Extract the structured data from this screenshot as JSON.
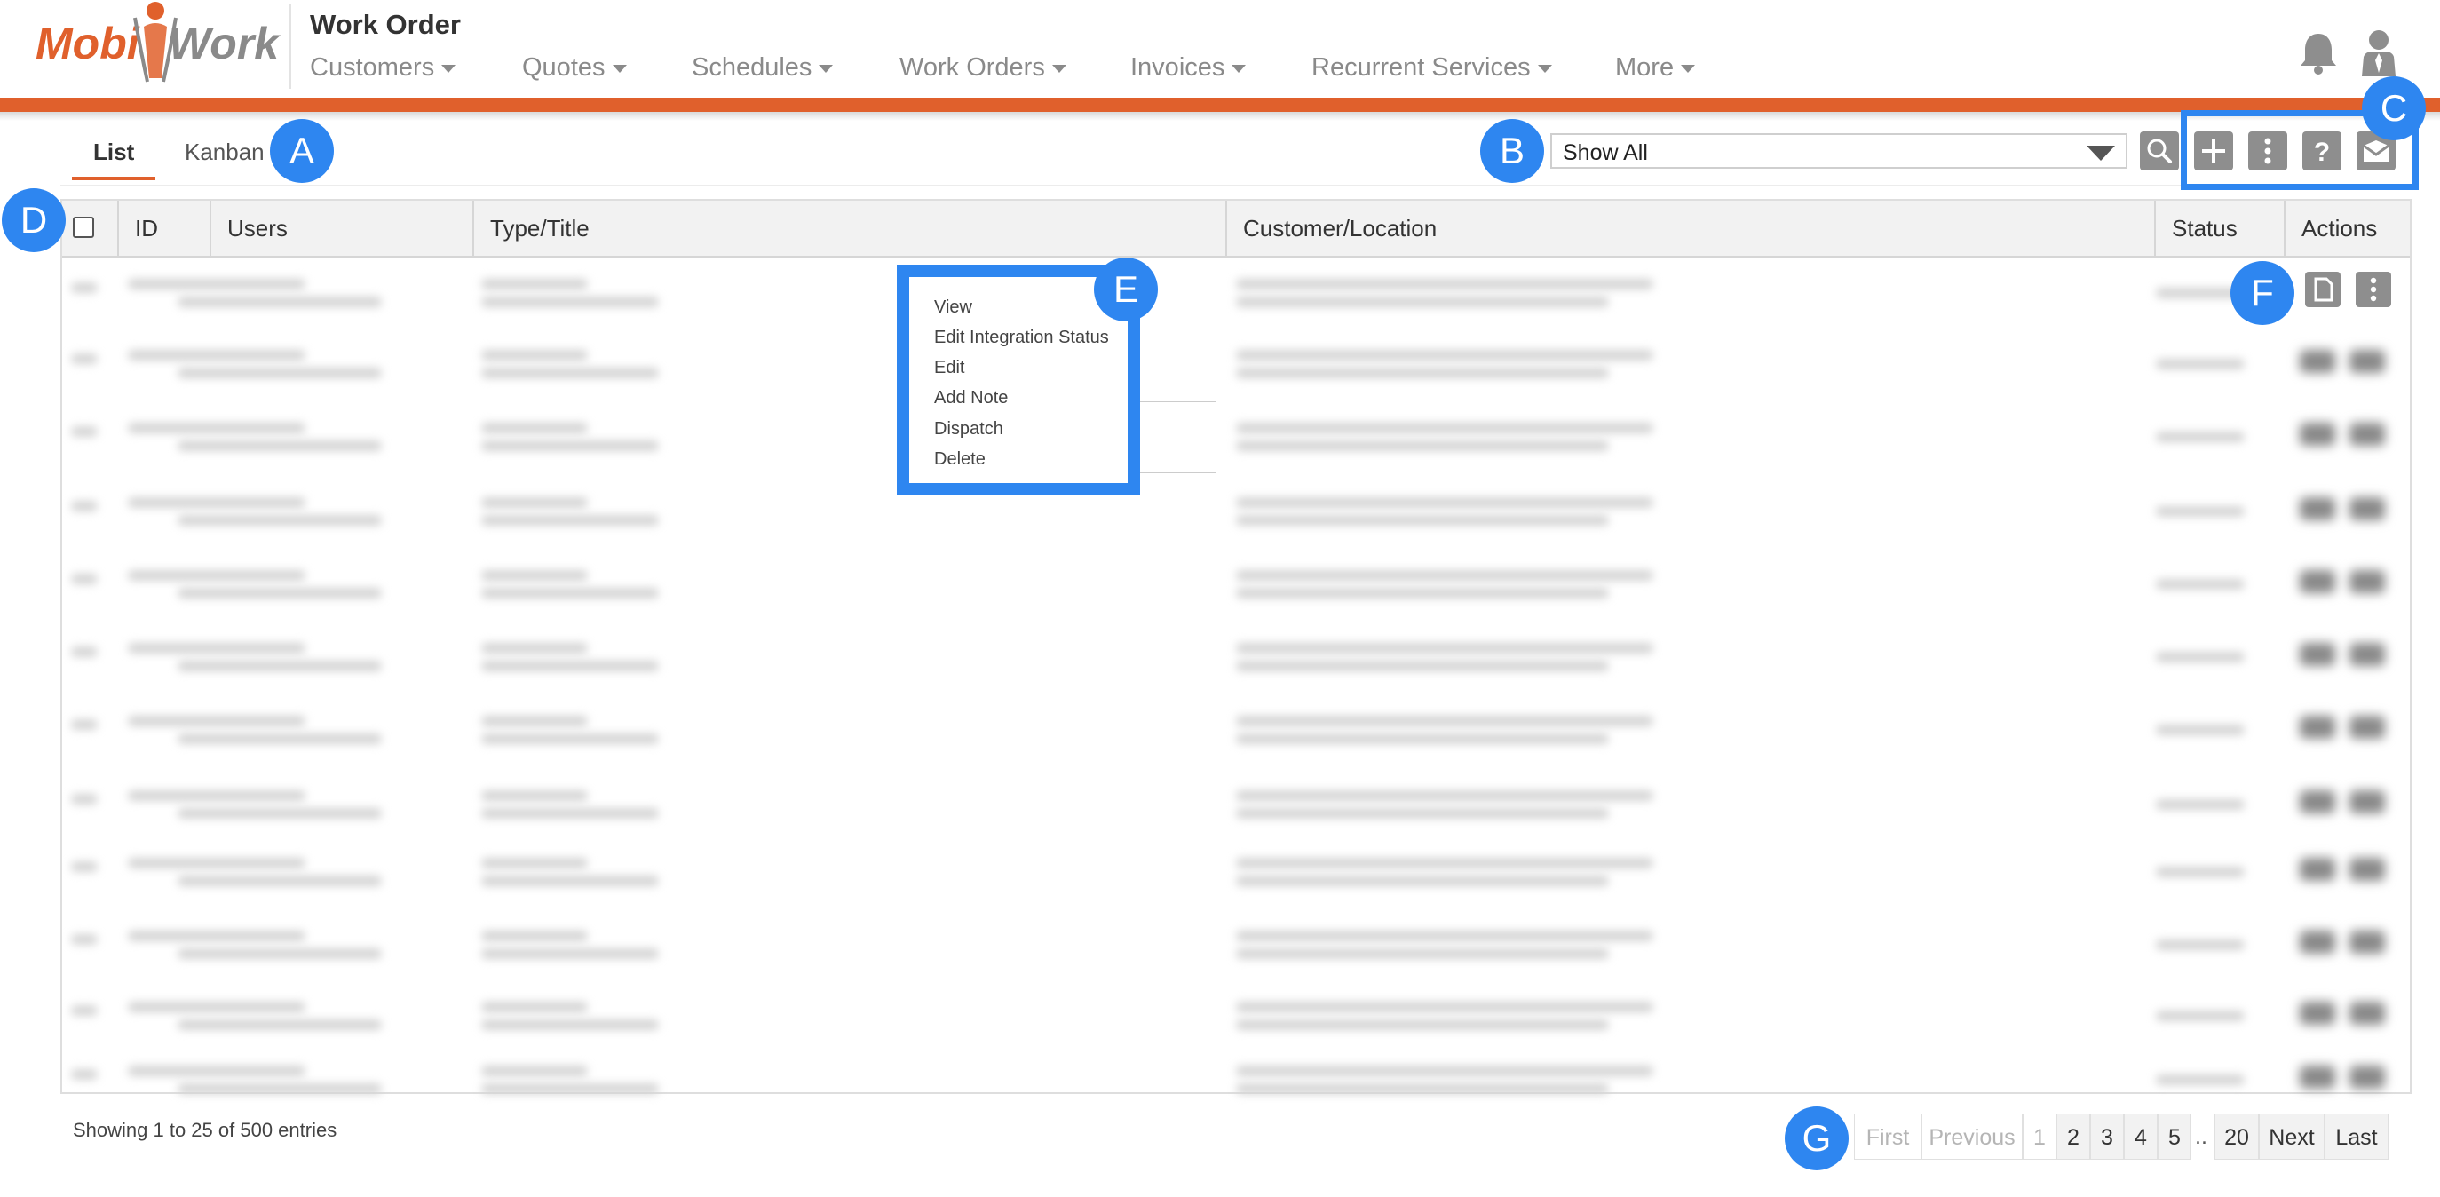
{
  "app": {
    "logo_text_left": "Mobi",
    "logo_text_right": "Work",
    "page_title": "Work Order"
  },
  "nav": {
    "items": [
      {
        "label": "Customers"
      },
      {
        "label": "Quotes"
      },
      {
        "label": "Schedules"
      },
      {
        "label": "Work Orders"
      },
      {
        "label": "Invoices"
      },
      {
        "label": "Recurrent Services"
      },
      {
        "label": "More"
      }
    ]
  },
  "tabs": {
    "list": "List",
    "kanban": "Kanban"
  },
  "filter": {
    "selected": "Show All"
  },
  "table": {
    "columns": [
      "ID",
      "Users",
      "Type/Title",
      "Customer/Location",
      "Status",
      "Actions"
    ]
  },
  "context_menu": {
    "items": [
      "View",
      "Edit Integration Status",
      "Edit",
      "Add Note",
      "Dispatch",
      "Delete"
    ]
  },
  "footer": {
    "entries_text": "Showing 1 to 25 of 500 entries"
  },
  "pagination": {
    "first": "First",
    "previous": "Previous",
    "pages": [
      "1",
      "2",
      "3",
      "4",
      "5"
    ],
    "ellipsis": "..",
    "last_page": "20",
    "next": "Next",
    "last": "Last"
  },
  "annotations": {
    "a": "A",
    "b": "B",
    "c": "C",
    "d": "D",
    "e": "E",
    "f": "F",
    "g": "G"
  },
  "colors": {
    "brand_orange": "#e0602c",
    "annotation_blue": "#2e86f0",
    "icon_gray": "#8e8e8e"
  }
}
